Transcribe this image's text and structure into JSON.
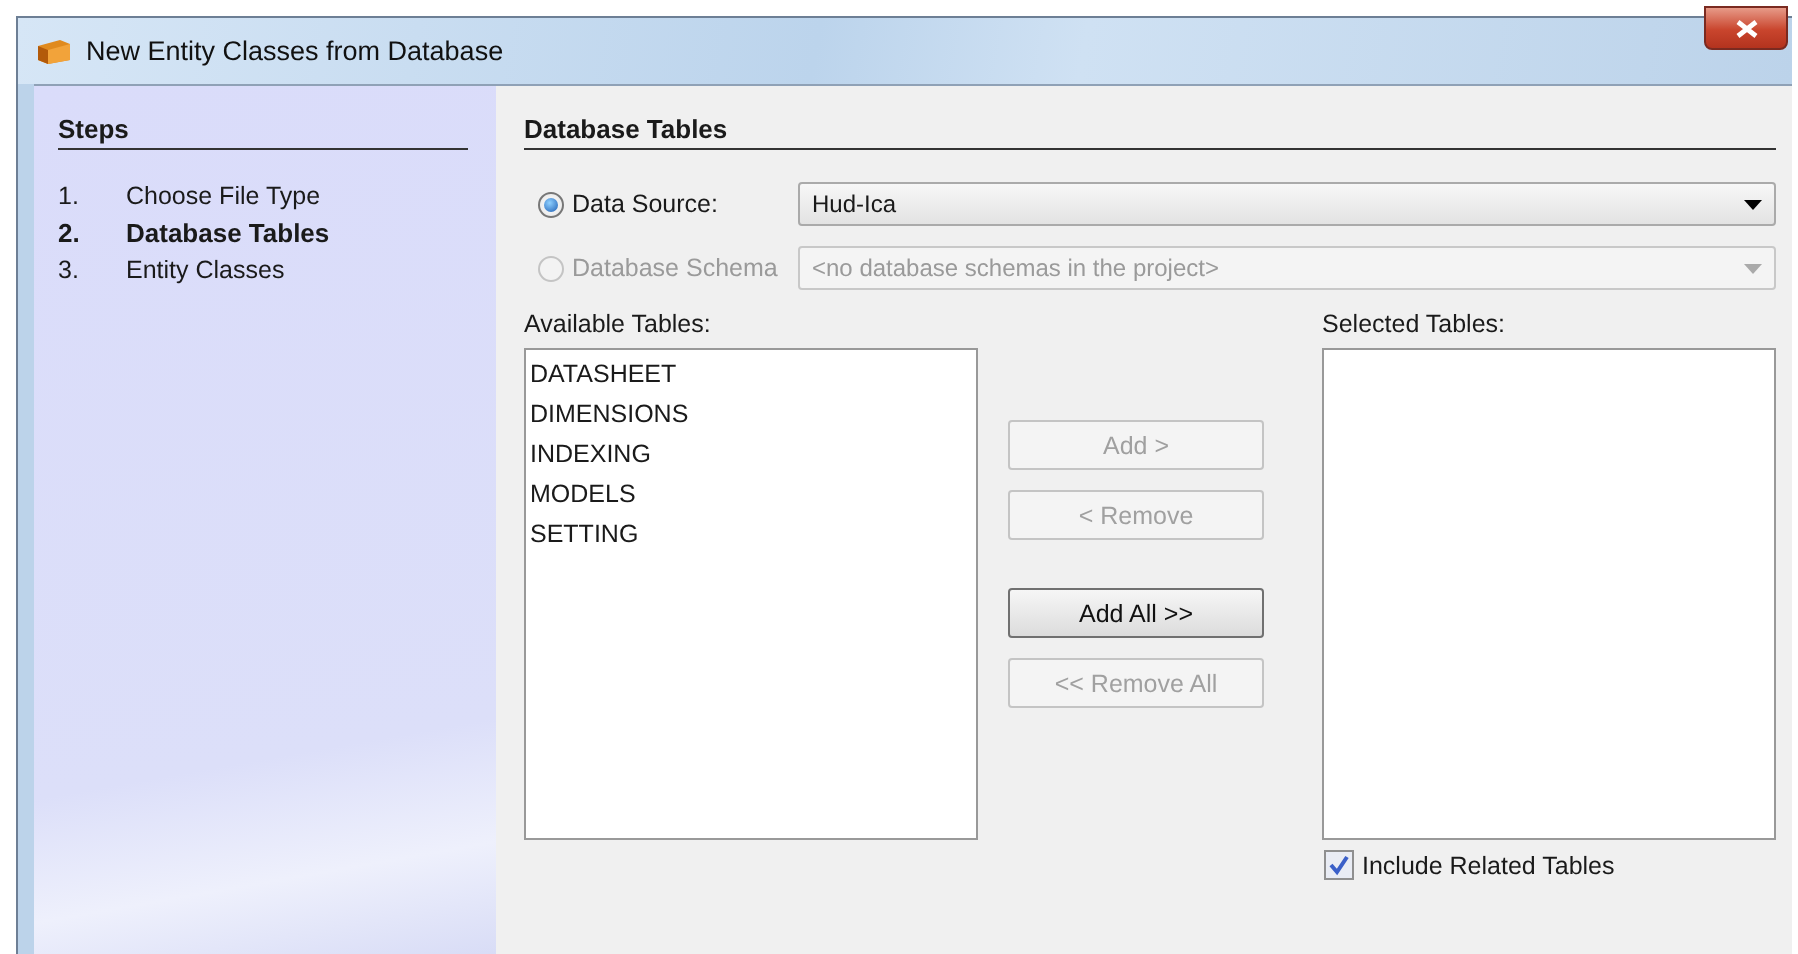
{
  "window": {
    "title": "New Entity Classes from Database"
  },
  "steps": {
    "heading": "Steps",
    "items": [
      {
        "number": "1.",
        "label": "Choose File Type",
        "selected": false
      },
      {
        "number": "2.",
        "label": "Database Tables",
        "selected": true
      },
      {
        "number": "3.",
        "label": "Entity Classes",
        "selected": false
      }
    ]
  },
  "panel": {
    "heading": "Database Tables",
    "sources": [
      {
        "label": "Data Source:",
        "value": "Hud-Ica",
        "selected": true,
        "disabled": false
      },
      {
        "label": "Database Schema",
        "value": "<no database schemas in the project>",
        "selected": false,
        "disabled": true
      }
    ],
    "available": {
      "label": "Available Tables:",
      "items": [
        "DATASHEET",
        "DIMENSIONS",
        "INDEXING",
        "MODELS",
        "SETTING"
      ]
    },
    "buttons": [
      {
        "label": "Add >",
        "disabled": true
      },
      {
        "label": "< Remove",
        "disabled": true
      },
      {
        "label": "Add All >>",
        "disabled": false
      },
      {
        "label": "<< Remove All",
        "disabled": true
      }
    ],
    "selected_tables": {
      "label": "Selected Tables:"
    },
    "include_related": {
      "label": "Include Related Tables",
      "checked": true
    }
  }
}
